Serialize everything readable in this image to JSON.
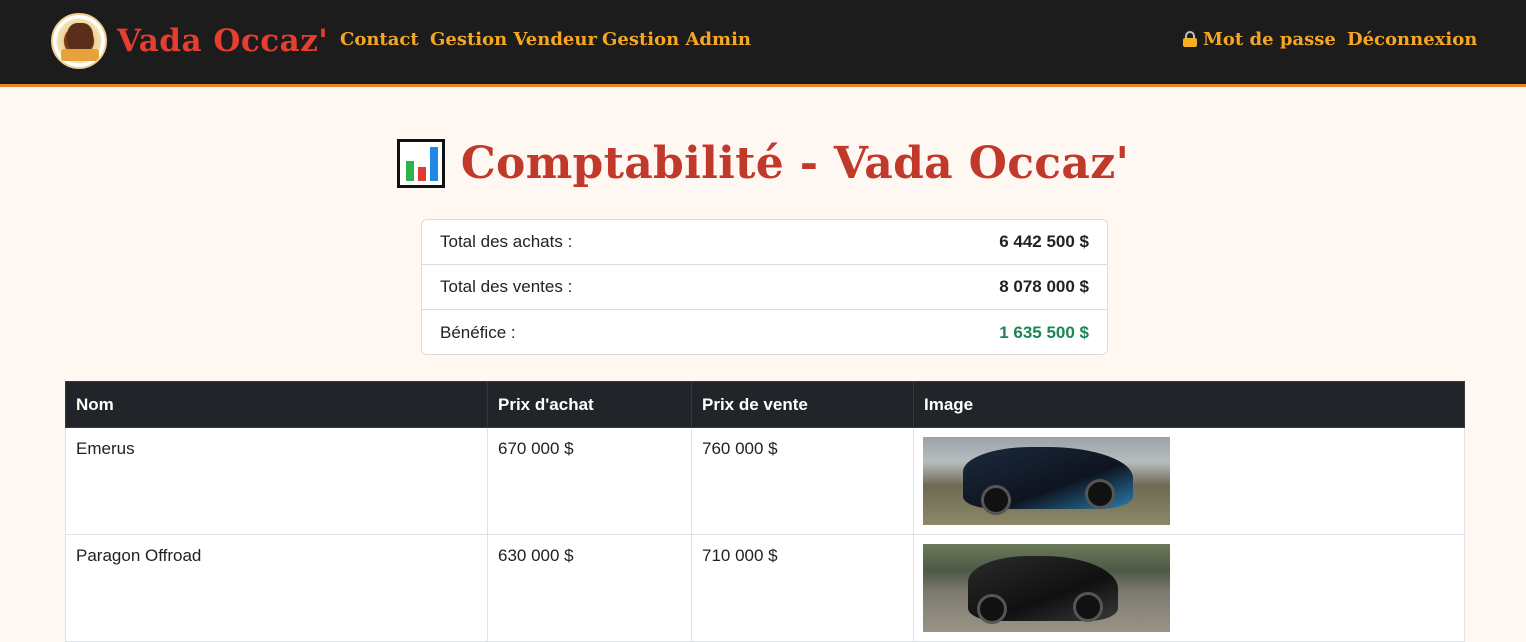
{
  "navbar": {
    "brand": "Vada Occaz'",
    "links": [
      "Contact",
      "Gestion Vendeur",
      "Gestion Admin"
    ],
    "password_label": "Mot de passe",
    "logout_label": "Déconnexion"
  },
  "page": {
    "title": "Comptabilité - Vada Occaz'"
  },
  "summary": [
    {
      "label": "Total des achats :",
      "value": "6 442 500 $"
    },
    {
      "label": "Total des ventes :",
      "value": "8 078 000 $"
    },
    {
      "label": "Bénéfice :",
      "value": "1 635 500 $"
    }
  ],
  "table": {
    "headers": [
      "Nom",
      "Prix d'achat",
      "Prix de vente",
      "Image"
    ],
    "rows": [
      {
        "name": "Emerus",
        "purchase": "670 000 $",
        "sale": "760 000 $",
        "image": "car-photo-emerus"
      },
      {
        "name": "Paragon Offroad",
        "purchase": "630 000 $",
        "sale": "710 000 $",
        "image": "car-photo-paragon-offroad"
      }
    ]
  },
  "colors": {
    "navbar_bg": "#1c1c1c",
    "accent_orange": "#e8862d",
    "nav_link": "#f5a623",
    "brand_red": "#e53e2f",
    "title_red": "#c0392b",
    "profit_green": "#198754",
    "table_header_bg": "#212529"
  },
  "icons": {
    "logo": "vada-occaz-logo",
    "lock": "lock-icon",
    "chart": "bar-chart-icon"
  }
}
